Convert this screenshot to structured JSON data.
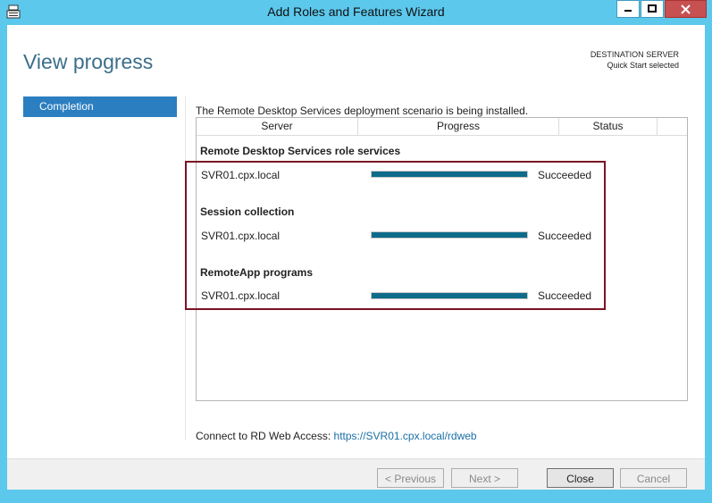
{
  "window": {
    "title": "Add Roles and Features Wizard",
    "icons": {
      "app": "server-manager-icon",
      "minimize": "minimize-icon",
      "maximize": "maximize-icon",
      "close": "close-icon"
    }
  },
  "page": {
    "title": "View progress",
    "destination_label": "DESTINATION SERVER",
    "destination_value": "Quick Start selected"
  },
  "sidebar": {
    "items": [
      {
        "label": "Completion",
        "selected": true
      }
    ]
  },
  "main": {
    "description": "The Remote Desktop Services deployment scenario is being installed.",
    "columns": {
      "server": "Server",
      "progress": "Progress",
      "status": "Status"
    },
    "groups": [
      {
        "title": "Remote Desktop Services role services",
        "rows": [
          {
            "server": "SVR01.cpx.local",
            "progress": 1.0,
            "status": "Succeeded"
          }
        ]
      },
      {
        "title": "Session collection",
        "rows": [
          {
            "server": "SVR01.cpx.local",
            "progress": 1.0,
            "status": "Succeeded"
          }
        ]
      },
      {
        "title": "RemoteApp programs",
        "rows": [
          {
            "server": "SVR01.cpx.local",
            "progress": 1.0,
            "status": "Succeeded"
          }
        ]
      }
    ],
    "connect_label": "Connect to RD Web Access:",
    "connect_link": "https://SVR01.cpx.local/rdweb"
  },
  "footer": {
    "previous_label": "< Previous",
    "next_label": "Next >",
    "close_label": "Close",
    "cancel_label": "Cancel"
  },
  "colors": {
    "title_bar": "#5cc8ec",
    "accent": "#2b7ec0",
    "progress_fill": "#0e6b8a",
    "highlight_border": "#7a1324",
    "link": "#1a6fa5"
  }
}
